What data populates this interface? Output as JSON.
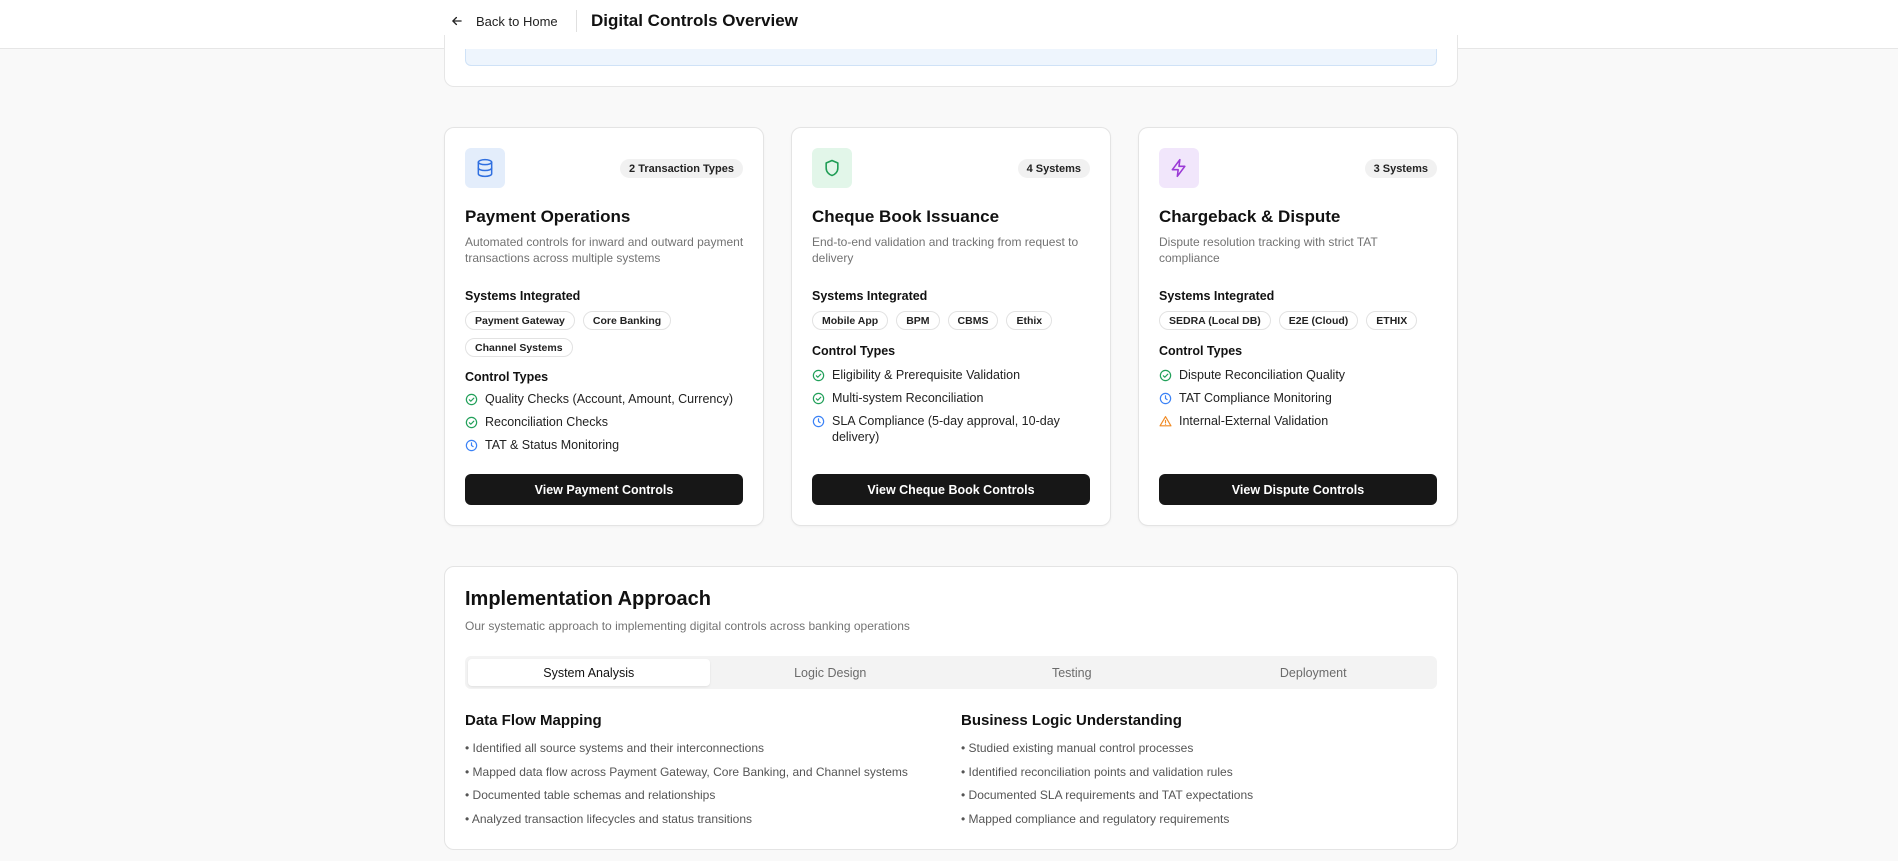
{
  "header": {
    "back_label": "Back to Home",
    "title": "Digital Controls Overview"
  },
  "cards": [
    {
      "icon": "database-icon",
      "icon_bg": "#e3edfb",
      "icon_color": "#2f6fe0",
      "badge": "2 Transaction Types",
      "title": "Payment Operations",
      "description": "Automated controls for inward and outward payment transactions across multiple systems",
      "systems_label": "Systems Integrated",
      "systems": [
        "Payment Gateway",
        "Core Banking",
        "Channel Systems"
      ],
      "controls_label": "Control Types",
      "controls": [
        {
          "icon": "check-circle-icon",
          "text": "Quality Checks (Account, Amount, Currency)"
        },
        {
          "icon": "check-circle-icon",
          "text": "Reconciliation Checks"
        },
        {
          "icon": "clock-icon",
          "text": "TAT & Status Monitoring"
        }
      ],
      "button": "View Payment Controls"
    },
    {
      "icon": "shield-icon",
      "icon_bg": "#e2f6e9",
      "icon_color": "#1f9d55",
      "badge": "4 Systems",
      "title": "Cheque Book Issuance",
      "description": "End-to-end validation and tracking from request to delivery",
      "systems_label": "Systems Integrated",
      "systems": [
        "Mobile App",
        "BPM",
        "CBMS",
        "Ethix"
      ],
      "controls_label": "Control Types",
      "controls": [
        {
          "icon": "check-circle-icon",
          "text": "Eligibility & Prerequisite Validation"
        },
        {
          "icon": "check-circle-icon",
          "text": "Multi-system Reconciliation"
        },
        {
          "icon": "clock-icon",
          "text": "SLA Compliance (5-day approval, 10-day delivery)"
        }
      ],
      "button": "View Cheque Book Controls"
    },
    {
      "icon": "lightning-icon",
      "icon_bg": "#f1e6fb",
      "icon_color": "#9b3ad6",
      "badge": "3 Systems",
      "title": "Chargeback & Dispute",
      "description": "Dispute resolution tracking with strict TAT compliance",
      "systems_label": "Systems Integrated",
      "systems": [
        "SEDRA (Local DB)",
        "E2E (Cloud)",
        "ETHIX"
      ],
      "controls_label": "Control Types",
      "controls": [
        {
          "icon": "check-circle-icon",
          "text": "Dispute Reconciliation Quality"
        },
        {
          "icon": "clock-icon",
          "text": "TAT Compliance Monitoring"
        },
        {
          "icon": "warning-icon",
          "text": "Internal-External Validation"
        }
      ],
      "button": "View Dispute Controls"
    }
  ],
  "implementation": {
    "title": "Implementation Approach",
    "subtitle": "Our systematic approach to implementing digital controls across banking operations",
    "tabs": [
      "System Analysis",
      "Logic Design",
      "Testing",
      "Deployment"
    ],
    "active_tab": "System Analysis",
    "columns": [
      {
        "title": "Data Flow Mapping",
        "items": [
          "• Identified all source systems and their interconnections",
          "• Mapped data flow across Payment Gateway, Core Banking, and Channel systems",
          "• Documented table schemas and relationships",
          "• Analyzed transaction lifecycles and status transitions"
        ]
      },
      {
        "title": "Business Logic Understanding",
        "items": [
          "• Studied existing manual control processes",
          "• Identified reconciliation points and validation rules",
          "• Documented SLA requirements and TAT expectations",
          "• Mapped compliance and regulatory requirements"
        ]
      }
    ]
  },
  "colors": {
    "check": "#22a05a",
    "clock": "#3b82f6",
    "warning": "#f08a24",
    "button_bg": "#171717"
  }
}
